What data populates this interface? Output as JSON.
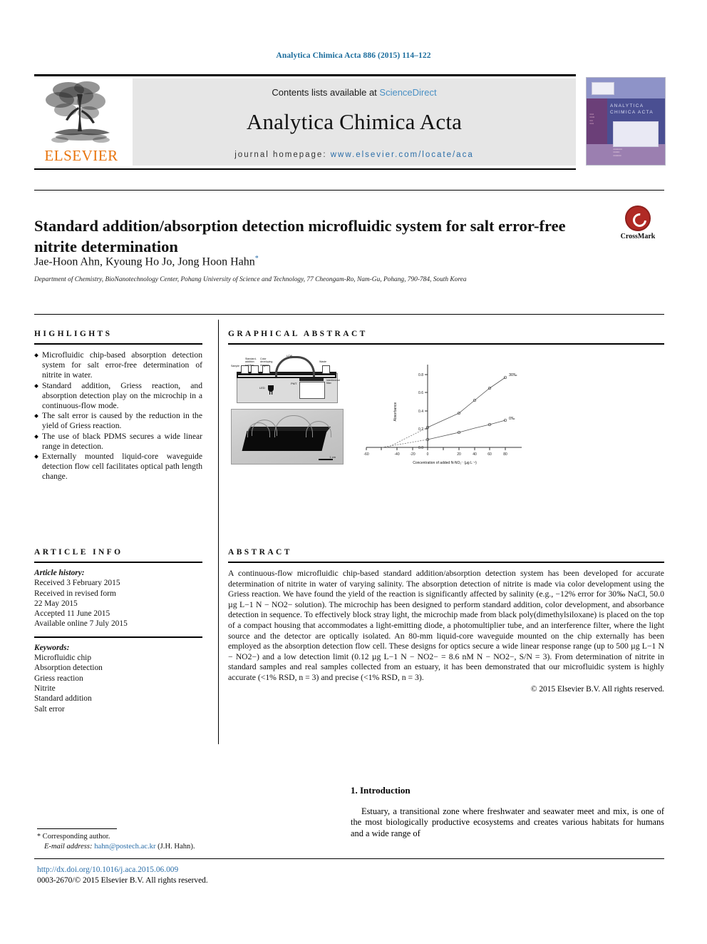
{
  "running_head": "Analytica Chimica Acta 886 (2015) 114–122",
  "masthead": {
    "contents_prefix": "Contents lists available at ",
    "sciencedirect": "ScienceDirect",
    "journal_name": "Analytica Chimica Acta",
    "homepage_prefix": "journal homepage: ",
    "homepage_url": "www.elsevier.com/locate/aca",
    "publisher": "ELSEVIER",
    "cover_title": "ANALYTICA CHIMICA ACTA",
    "accent_orange": "#E8740C",
    "accent_blue": "#2b6ea8"
  },
  "article": {
    "title": "Standard addition/absorption detection microfluidic system for salt error-free nitrite determination",
    "authors": "Jae-Hoon Ahn, Kyoung Ho Jo, Jong Hoon Hahn",
    "corresponding_marker": "*",
    "affiliation": "Department of Chemistry, BioNanotechnology Center, Pohang University of Science and Technology, 77 Cheongam-Ro, Nam-Gu, Pohang, 790-784, South Korea",
    "crossmark_label": "CrossMark"
  },
  "highlights": {
    "heading": "HIGHLIGHTS",
    "items": [
      "Microfluidic chip-based absorption detection system for salt error-free determination of nitrite in water.",
      "Standard addition, Griess reaction, and absorption detection play on the microchip in a continuous-flow mode.",
      "The salt error is caused by the reduction in the yield of Griess reaction.",
      "The use of black PDMS secures a wide linear range in detection.",
      "Externally mounted liquid-core waveguide detection flow cell facilitates optical path length change."
    ]
  },
  "article_info": {
    "heading": "ARTICLE INFO",
    "history_label": "Article history:",
    "history": [
      "Received 3 February 2015",
      "Received in revised form",
      "22 May 2015",
      "Accepted 11 June 2015",
      "Available online 7 July 2015"
    ],
    "keywords_label": "Keywords:",
    "keywords": [
      "Microfluidic chip",
      "Absorption detection",
      "Griess reaction",
      "Nitrite",
      "Standard addition",
      "Salt error"
    ]
  },
  "graphical_abstract": {
    "heading": "GRAPHICAL ABSTRACT",
    "schematic_labels": {
      "sample": "Sample",
      "standard": "Standard-addition solution",
      "reagent": "Color developing reagent",
      "lcw": "LCW",
      "waste": "Waste",
      "led": "LED",
      "pmt": "PMT",
      "filter": "Interference filter"
    },
    "photo_scalebar": "1 cm"
  },
  "chart_data": {
    "type": "line",
    "title": "",
    "xlabel": "Concentration of added N-NO2- (µg L-1)",
    "ylabel": "Absorbance",
    "x": [
      0,
      20,
      40,
      60,
      80
    ],
    "xticks": [
      -60,
      -40,
      -20,
      0,
      20,
      40,
      60,
      80
    ],
    "yticks": [
      0.0,
      0.2,
      0.4,
      0.6,
      0.8
    ],
    "xlim": [
      -60,
      85
    ],
    "ylim": [
      0.0,
      0.9
    ],
    "grid": false,
    "legend_position": "inline-right",
    "series": [
      {
        "name": "30‰",
        "values": [
          0.22,
          0.38,
          0.54,
          0.68,
          0.82
        ]
      },
      {
        "name": "0‰",
        "values": [
          0.08,
          0.13,
          0.18,
          0.23,
          0.28
        ]
      }
    ]
  },
  "abstract": {
    "heading": "ABSTRACT",
    "text": "A continuous-flow microfluidic chip-based standard addition/absorption detection system has been developed for accurate determination of nitrite in water of varying salinity. The absorption detection of nitrite is made via color development using the Griess reaction. We have found the yield of the reaction is significantly affected by salinity (e.g., −12% error for 30‰ NaCl, 50.0 µg L−1 N − NO2− solution). The microchip has been designed to perform standard addition, color development, and absorbance detection in sequence. To effectively block stray light, the microchip made from black poly(dimethylsiloxane) is placed on the top of a compact housing that accommodates a light-emitting diode, a photomultiplier tube, and an interference filter, where the light source and the detector are optically isolated. An 80-mm liquid-core waveguide mounted on the chip externally has been employed as the absorption detection flow cell. These designs for optics secure a wide linear response range (up to 500 µg L−1 N − NO2−) and a low detection limit (0.12 µg L−1 N − NO2− = 8.6 nM N − NO2−, S/N = 3). From determination of nitrite in standard samples and real samples collected from an estuary, it has been demonstrated that our microfluidic system is highly accurate (<1% RSD, n = 3) and precise (<1% RSD, n = 3).",
    "copyright": "© 2015 Elsevier B.V. All rights reserved."
  },
  "introduction": {
    "heading": "1.  Introduction",
    "paragraph": "Estuary, a transitional zone where freshwater and seawater meet and mix, is one of the most biologically productive ecosystems and creates various habitats for humans and a wide range of"
  },
  "footer": {
    "corresponding_note": "Corresponding author.",
    "email_label": "E-mail address:",
    "email": "hahn@postech.ac.kr",
    "email_suffix": "(J.H. Hahn).",
    "doi": "http://dx.doi.org/10.1016/j.aca.2015.06.009",
    "issn_line": "0003-2670/© 2015 Elsevier B.V. All rights reserved."
  }
}
